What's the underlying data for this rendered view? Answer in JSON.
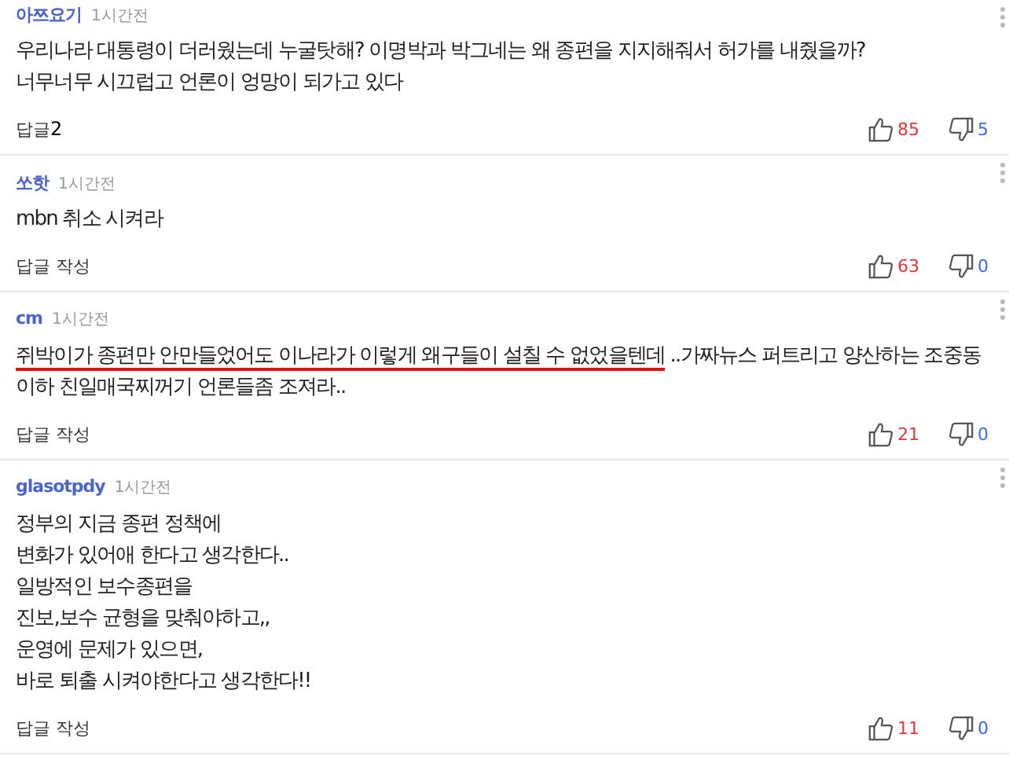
{
  "comments": [
    {
      "author": "아쯔요기",
      "time": "1시간전",
      "body": [
        {
          "text": "우리나라 대통령이 더러웠는데 누굴탓해? 이명박과 박그네는 왜 종편을 지지해줘서 허가를 내줬을까?\n너무너무 시끄럽고 언론이 엉망이 되가고 있다",
          "underlined": false
        }
      ],
      "reply_label": "답글",
      "reply_count": "2",
      "likes": "85",
      "dislikes": "5"
    },
    {
      "author": "쏘핫",
      "time": "1시간전",
      "body": [
        {
          "text": "mbn 취소 시켜라",
          "underlined": false
        }
      ],
      "reply_label": "답글 작성",
      "likes": "63",
      "dislikes": "0"
    },
    {
      "author": "cm",
      "time": "1시간전",
      "body": [
        {
          "text": "쥐박이가 종편만 안만들었어도 이나라가 이렇게 왜구들이 설칠 수 없었을텐데",
          "underlined": true
        },
        {
          "text": " ..가짜뉴스 퍼트리고 양산하는 조중동이하 친일매국찌꺼기 언론들좀 조져라..",
          "underlined": false
        }
      ],
      "reply_label": "답글 작성",
      "likes": "21",
      "dislikes": "0"
    },
    {
      "author": "glasotpdy",
      "time": "1시간전",
      "body": [
        {
          "text": "정부의 지금 종편 정책에\n변화가 있어애 한다고 생각한다..\n일방적인 보수종편을\n진보,보수 균형을 맞춰야하고,,\n운영에 문제가 있으면,\n바로 퇴출 시켜야한다고 생각한다!!",
          "underlined": false
        }
      ],
      "reply_label": "답글 작성",
      "likes": "11",
      "dislikes": "0"
    }
  ]
}
